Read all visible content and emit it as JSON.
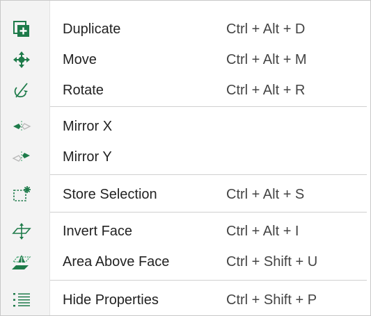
{
  "colors": {
    "icon_green": "#1e7b4a",
    "icon_light_green": "#3aa06a",
    "icon_gray": "#b8b8b8"
  },
  "menu": {
    "items": [
      {
        "label": "Duplicate",
        "shortcut": "Ctrl + Alt + D",
        "icon": "duplicate-icon"
      },
      {
        "label": "Move",
        "shortcut": "Ctrl + Alt + M",
        "icon": "move-icon"
      },
      {
        "label": "Rotate",
        "shortcut": "Ctrl + Alt + R",
        "icon": "rotate-icon"
      },
      {
        "label": "Mirror X",
        "shortcut": "",
        "icon": "mirror-x-icon"
      },
      {
        "label": "Mirror Y",
        "shortcut": "",
        "icon": "mirror-y-icon"
      },
      {
        "label": "Store Selection",
        "shortcut": "Ctrl + Alt + S",
        "icon": "store-selection-icon"
      },
      {
        "label": "Invert Face",
        "shortcut": "Ctrl + Alt + I",
        "icon": "invert-face-icon"
      },
      {
        "label": "Area Above Face",
        "shortcut": "Ctrl + Shift + U",
        "icon": "area-above-face-icon"
      },
      {
        "label": "Hide Properties",
        "shortcut": "Ctrl + Shift + P",
        "icon": "list-icon"
      }
    ]
  }
}
